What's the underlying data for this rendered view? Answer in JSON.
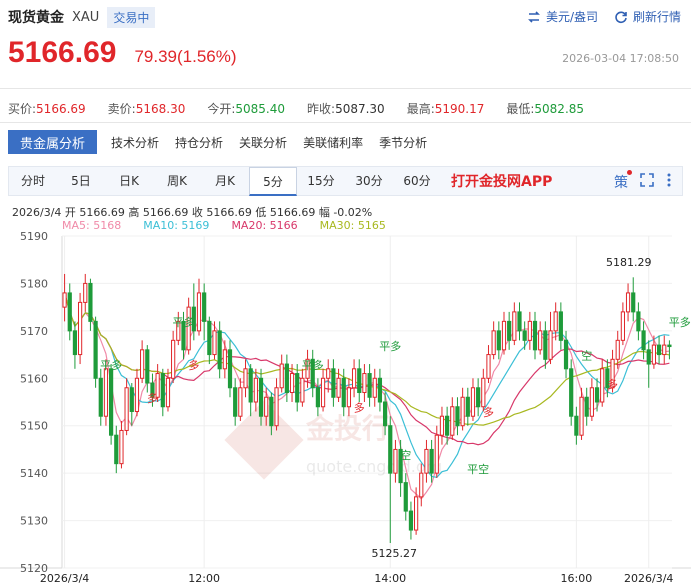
{
  "header": {
    "name": "现货黄金",
    "code": "XAU",
    "status": "交易中",
    "currency_label": "美元/盎司",
    "refresh_label": "刷新行情"
  },
  "price": {
    "last": "5166.69",
    "change": "79.39(1.56%)",
    "timestamp": "2026-03-04 17:08:50"
  },
  "quote": [
    {
      "label": "买价:",
      "value": "5166.69",
      "color": "red"
    },
    {
      "label": "卖价:",
      "value": "5168.30",
      "color": "red"
    },
    {
      "label": "今开:",
      "value": "5085.40",
      "color": "green"
    },
    {
      "label": "昨收:",
      "value": "5087.30",
      "color": "plain"
    },
    {
      "label": "最高:",
      "value": "5190.17",
      "color": "red"
    },
    {
      "label": "最低:",
      "value": "5082.85",
      "color": "green"
    }
  ],
  "analysis_tabs": [
    "贵金属分析",
    "技术分析",
    "持仓分析",
    "关联分析",
    "美联储利率",
    "季节分析"
  ],
  "periods": [
    "分时",
    "5日",
    "日K",
    "周K",
    "月K",
    "5分",
    "15分",
    "30分",
    "60分"
  ],
  "active_period": "5分",
  "app_link": "打开金投网APP",
  "tool_icon_char": "策",
  "ohlc_text": "2026/3/4  开 5166.69  高 5166.69  收 5166.69  低 5166.69  幅 -0.02%",
  "ma_legend": [
    {
      "label": "MA5: 5168",
      "color": "#f08aa8"
    },
    {
      "label": "MA10: 5169",
      "color": "#3bbfd6"
    },
    {
      "label": "MA20: 5166",
      "color": "#d8386a"
    },
    {
      "label": "MA30: 5165",
      "color": "#a8b820"
    }
  ],
  "colors": {
    "up": "#e0262a",
    "down": "#1e9b3a",
    "accent": "#3a6fc4"
  },
  "watermark": {
    "brand": "金投行",
    "url": "quote.cngold.org"
  },
  "chart_data": {
    "type": "candlestick",
    "ylim": [
      5120,
      5190
    ],
    "y_ticks": [
      5190,
      5180,
      5170,
      5160,
      5150,
      5140,
      5130,
      5120
    ],
    "x_tick_labels": [
      "2026/3/4",
      "12:00",
      "14:00",
      "16:00",
      "2026/3/4"
    ],
    "x_tick_index": [
      0,
      27,
      63,
      99,
      113
    ],
    "annotations": {
      "high": {
        "label": "5181.29",
        "index": 113
      },
      "low": {
        "label": "5125.27",
        "index": 63
      }
    },
    "signal_labels": [
      {
        "text": "平多",
        "index": 9,
        "value": 5162,
        "kind": "exit"
      },
      {
        "text": "多",
        "index": 17,
        "value": 5155,
        "kind": "buy"
      },
      {
        "text": "平多",
        "index": 23,
        "value": 5171,
        "kind": "exit"
      },
      {
        "text": "多",
        "index": 25,
        "value": 5162,
        "kind": "buy"
      },
      {
        "text": "平多",
        "index": 48,
        "value": 5162,
        "kind": "exit"
      },
      {
        "text": "多",
        "index": 57,
        "value": 5153,
        "kind": "buy"
      },
      {
        "text": "平多",
        "index": 63,
        "value": 5166,
        "kind": "exit"
      },
      {
        "text": "空",
        "index": 66,
        "value": 5143,
        "kind": "sell"
      },
      {
        "text": "平空",
        "index": 80,
        "value": 5140,
        "kind": "exit"
      },
      {
        "text": "多",
        "index": 82,
        "value": 5152,
        "kind": "buy"
      },
      {
        "text": "空",
        "index": 101,
        "value": 5164,
        "kind": "sell"
      },
      {
        "text": "多",
        "index": 106,
        "value": 5158,
        "kind": "buy"
      },
      {
        "text": "平多",
        "index": 119,
        "value": 5171,
        "kind": "exit"
      }
    ],
    "candles": [
      [
        5175,
        5178,
        5172,
        5182
      ],
      [
        5178,
        5170,
        5168,
        5180
      ],
      [
        5170,
        5165,
        5162,
        5172
      ],
      [
        5165,
        5176,
        5163,
        5178
      ],
      [
        5176,
        5180,
        5174,
        5182
      ],
      [
        5180,
        5172,
        5170,
        5181
      ],
      [
        5172,
        5160,
        5158,
        5173
      ],
      [
        5160,
        5152,
        5150,
        5162
      ],
      [
        5152,
        5162,
        5150,
        5164
      ],
      [
        5162,
        5148,
        5146,
        5163
      ],
      [
        5148,
        5142,
        5140,
        5150
      ],
      [
        5142,
        5149,
        5141,
        5151
      ],
      [
        5149,
        5158,
        5148,
        5160
      ],
      [
        5158,
        5153,
        5150,
        5159
      ],
      [
        5153,
        5160,
        5152,
        5162
      ],
      [
        5160,
        5166,
        5159,
        5168
      ],
      [
        5166,
        5159,
        5157,
        5167
      ],
      [
        5159,
        5156,
        5154,
        5161
      ],
      [
        5156,
        5161,
        5155,
        5163
      ],
      [
        5161,
        5154,
        5152,
        5162
      ],
      [
        5154,
        5160,
        5153,
        5162
      ],
      [
        5160,
        5168,
        5159,
        5170
      ],
      [
        5168,
        5172,
        5167,
        5174
      ],
      [
        5172,
        5166,
        5164,
        5174
      ],
      [
        5166,
        5175,
        5165,
        5177
      ],
      [
        5175,
        5170,
        5168,
        5180
      ],
      [
        5170,
        5178,
        5169,
        5181
      ],
      [
        5178,
        5172,
        5168,
        5180
      ],
      [
        5172,
        5165,
        5163,
        5173
      ],
      [
        5165,
        5170,
        5164,
        5172
      ],
      [
        5170,
        5162,
        5160,
        5172
      ],
      [
        5162,
        5166,
        5160,
        5168
      ],
      [
        5166,
        5158,
        5156,
        5168
      ],
      [
        5158,
        5152,
        5150,
        5160
      ],
      [
        5152,
        5158,
        5151,
        5160
      ],
      [
        5158,
        5162,
        5156,
        5164
      ],
      [
        5162,
        5155,
        5152,
        5163
      ],
      [
        5155,
        5160,
        5153,
        5162
      ],
      [
        5160,
        5152,
        5150,
        5162
      ],
      [
        5152,
        5156,
        5150,
        5158
      ],
      [
        5156,
        5150,
        5148,
        5157
      ],
      [
        5150,
        5158,
        5149,
        5160
      ],
      [
        5158,
        5163,
        5157,
        5165
      ],
      [
        5163,
        5157,
        5155,
        5165
      ],
      [
        5157,
        5161,
        5155,
        5163
      ],
      [
        5161,
        5155,
        5153,
        5163
      ],
      [
        5155,
        5160,
        5154,
        5162
      ],
      [
        5160,
        5164,
        5158,
        5166
      ],
      [
        5164,
        5158,
        5156,
        5166
      ],
      [
        5158,
        5154,
        5152,
        5160
      ],
      [
        5154,
        5160,
        5153,
        5162
      ],
      [
        5160,
        5162,
        5157,
        5164
      ],
      [
        5162,
        5156,
        5154,
        5164
      ],
      [
        5156,
        5160,
        5155,
        5162
      ],
      [
        5160,
        5154,
        5152,
        5162
      ],
      [
        5154,
        5158,
        5152,
        5160
      ],
      [
        5158,
        5162,
        5156,
        5164
      ],
      [
        5162,
        5157,
        5155,
        5164
      ],
      [
        5157,
        5161,
        5155,
        5163
      ],
      [
        5161,
        5156,
        5154,
        5163
      ],
      [
        5156,
        5160,
        5154,
        5162
      ],
      [
        5160,
        5155,
        5153,
        5162
      ],
      [
        5155,
        5150,
        5148,
        5157
      ],
      [
        5150,
        5140,
        5125.27,
        5152
      ],
      [
        5140,
        5145,
        5138,
        5147
      ],
      [
        5145,
        5138,
        5135,
        5147
      ],
      [
        5138,
        5132,
        5130,
        5140
      ],
      [
        5132,
        5128,
        5126,
        5134
      ],
      [
        5128,
        5135,
        5127,
        5137
      ],
      [
        5135,
        5140,
        5133,
        5142
      ],
      [
        5140,
        5145,
        5138,
        5147
      ],
      [
        5145,
        5140,
        5138,
        5147
      ],
      [
        5140,
        5148,
        5139,
        5150
      ],
      [
        5148,
        5152,
        5146,
        5154
      ],
      [
        5152,
        5148,
        5146,
        5154
      ],
      [
        5148,
        5154,
        5147,
        5156
      ],
      [
        5154,
        5150,
        5148,
        5156
      ],
      [
        5150,
        5156,
        5149,
        5158
      ],
      [
        5156,
        5152,
        5150,
        5158
      ],
      [
        5152,
        5158,
        5151,
        5160
      ],
      [
        5158,
        5154,
        5152,
        5160
      ],
      [
        5154,
        5160,
        5153,
        5162
      ],
      [
        5160,
        5165,
        5159,
        5167
      ],
      [
        5165,
        5170,
        5164,
        5172
      ],
      [
        5170,
        5166,
        5164,
        5172
      ],
      [
        5166,
        5172,
        5165,
        5174
      ],
      [
        5172,
        5168,
        5166,
        5174
      ],
      [
        5168,
        5174,
        5167,
        5176
      ],
      [
        5174,
        5170,
        5168,
        5176
      ],
      [
        5170,
        5168,
        5166,
        5172
      ],
      [
        5168,
        5172,
        5166,
        5174
      ],
      [
        5172,
        5166,
        5164,
        5174
      ],
      [
        5166,
        5170,
        5165,
        5172
      ],
      [
        5170,
        5164,
        5162,
        5172
      ],
      [
        5164,
        5170,
        5163,
        5174
      ],
      [
        5170,
        5174,
        5168,
        5176
      ],
      [
        5174,
        5168,
        5166,
        5176
      ],
      [
        5168,
        5162,
        5160,
        5170
      ],
      [
        5162,
        5152,
        5150,
        5164
      ],
      [
        5152,
        5148,
        5146,
        5154
      ],
      [
        5148,
        5156,
        5147,
        5158
      ],
      [
        5156,
        5152,
        5150,
        5158
      ],
      [
        5152,
        5158,
        5151,
        5160
      ],
      [
        5158,
        5155,
        5153,
        5160
      ],
      [
        5155,
        5162,
        5154,
        5164
      ],
      [
        5162,
        5158,
        5156,
        5164
      ],
      [
        5158,
        5164,
        5157,
        5166
      ],
      [
        5164,
        5168,
        5162,
        5170
      ],
      [
        5168,
        5174,
        5167,
        5176
      ],
      [
        5174,
        5178,
        5172,
        5180
      ],
      [
        5178,
        5174,
        5172,
        5181.29
      ],
      [
        5174,
        5170,
        5168,
        5176
      ],
      [
        5170,
        5166,
        5164,
        5172
      ],
      [
        5166,
        5163,
        5158,
        5168
      ],
      [
        5163,
        5167,
        5162,
        5169
      ],
      [
        5167,
        5165,
        5163,
        5169
      ],
      [
        5165,
        5167,
        5163,
        5169
      ],
      [
        5167,
        5166.69,
        5164,
        5168
      ]
    ]
  }
}
